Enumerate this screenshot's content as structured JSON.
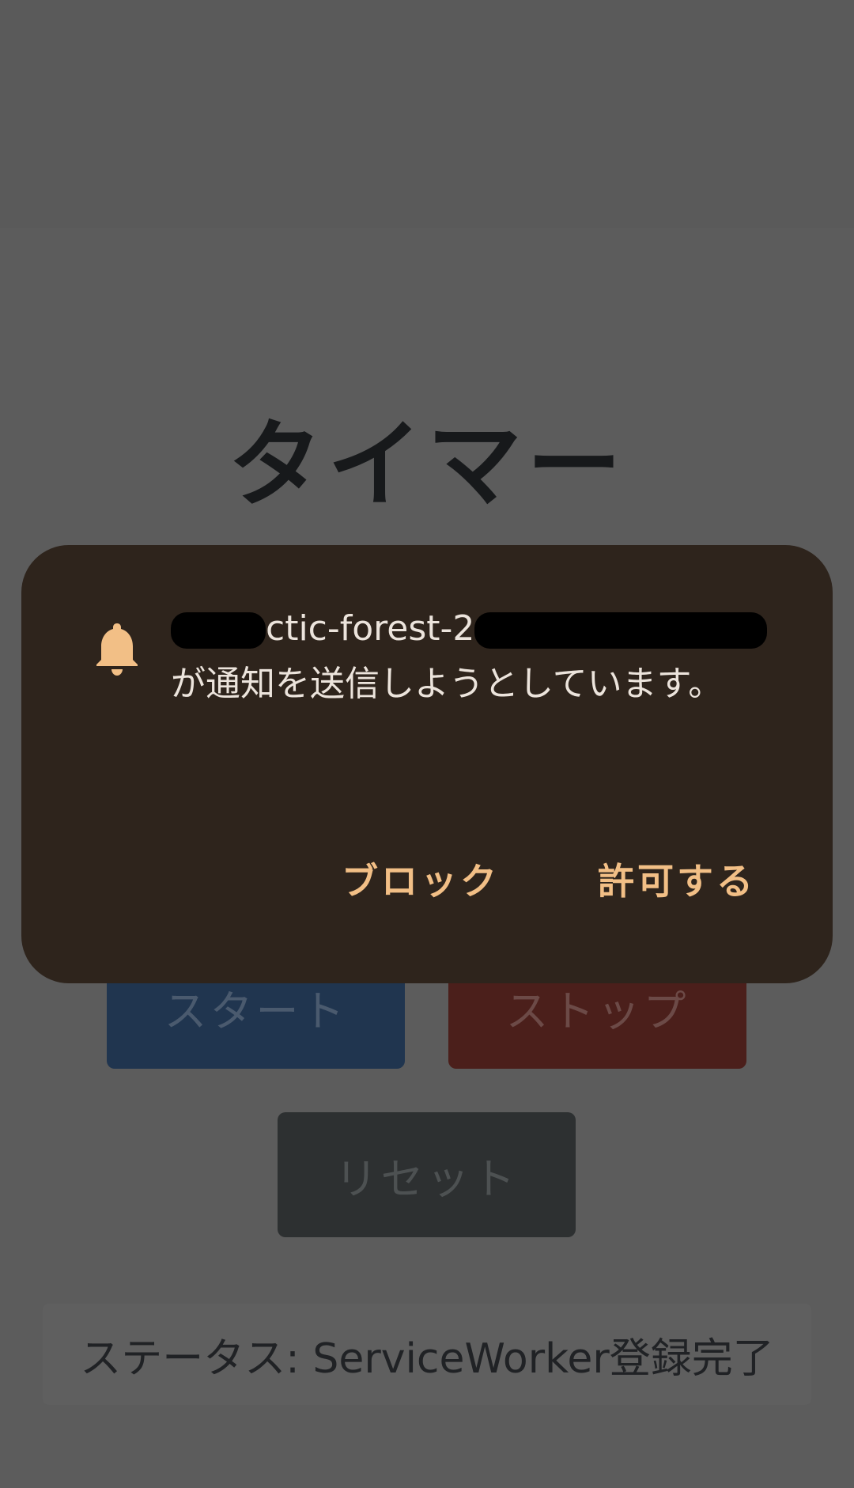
{
  "app": {
    "title": "タイマー"
  },
  "buttons": {
    "start": "スタート",
    "stop": "ストップ",
    "reset": "リセット"
  },
  "status": {
    "text": "ステータス: ServiceWorker登録完了"
  },
  "dialog": {
    "icon": "bell-icon",
    "site_visible_fragment": "ctic-forest-2",
    "message": "が通知を送信しようとしています。",
    "block_label": "ブロック",
    "allow_label": "許可する"
  },
  "colors": {
    "accent": "#f2bf86",
    "dialog_bg": "#2e241c",
    "start_bg": "#20354f",
    "stop_bg": "#4b1f1b",
    "reset_bg": "#2d3031"
  }
}
